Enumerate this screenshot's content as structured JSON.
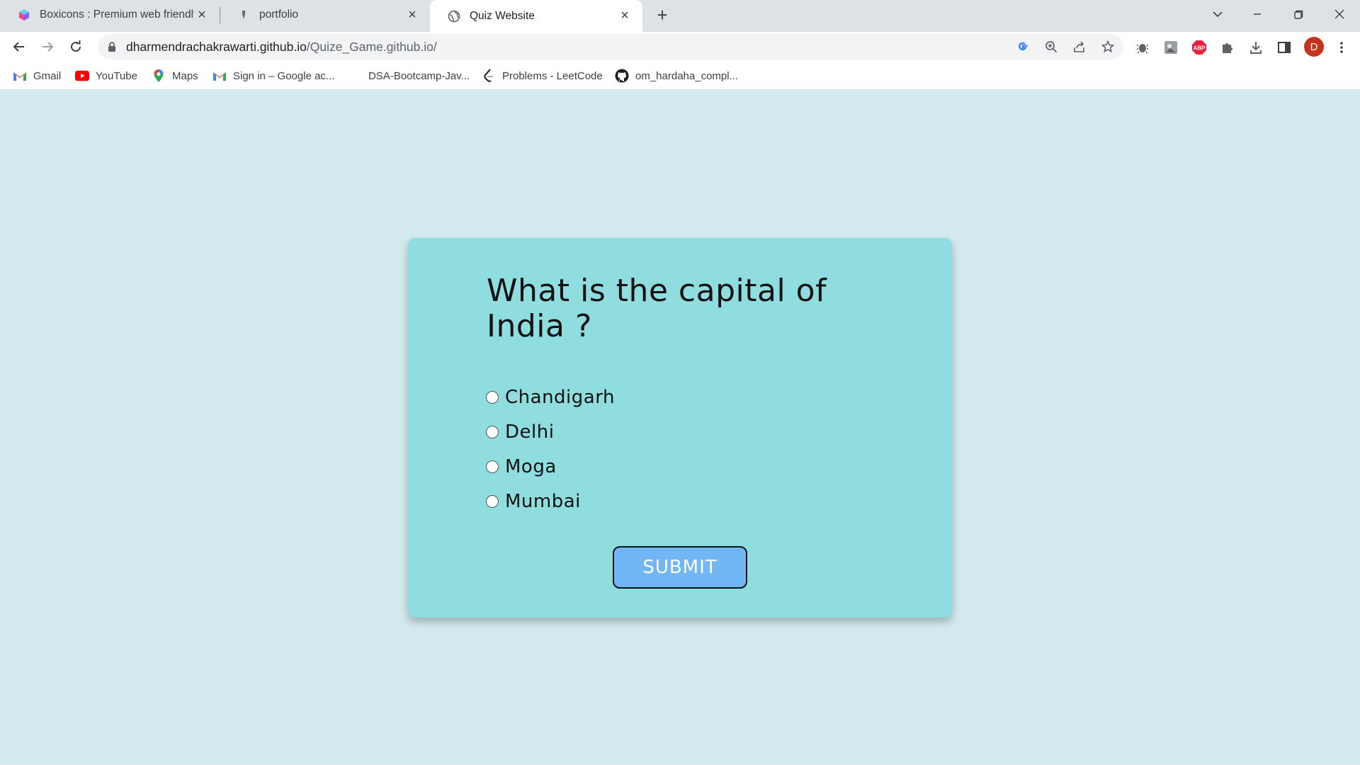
{
  "browser": {
    "tabs": [
      {
        "title": "Boxicons : Premium web friendly",
        "active": false
      },
      {
        "title": "portfolio",
        "active": false
      },
      {
        "title": "Quiz Website",
        "active": true
      }
    ],
    "new_tab_symbol": "+",
    "address": {
      "host": "dharmendrachakrawarti.github.io",
      "path": "/Quize_Game.github.io/"
    },
    "profile_initial": "D",
    "extension_badge": "ABP",
    "bookmarks": [
      {
        "label": "Gmail",
        "icon": "gmail-icon"
      },
      {
        "label": "YouTube",
        "icon": "youtube-icon"
      },
      {
        "label": "Maps",
        "icon": "maps-icon"
      },
      {
        "label": "Sign in – Google ac...",
        "icon": "gmail-icon"
      },
      {
        "label": "DSA-Bootcamp-Jav...",
        "icon": "none"
      },
      {
        "label": "Problems - LeetCode",
        "icon": "leetcode-icon"
      },
      {
        "label": "om_hardaha_compl...",
        "icon": "github-icon"
      }
    ]
  },
  "quiz": {
    "question": "What is the capital of India ?",
    "options": [
      "Chandigarh",
      "Delhi",
      "Moga",
      "Mumbai"
    ],
    "submit_label": "SUBMIT"
  },
  "colors": {
    "page_background": "#d3eaee",
    "card_background": "#8fdddf",
    "submit_background": "#72b7f5",
    "profile_avatar": "#c5331d"
  }
}
